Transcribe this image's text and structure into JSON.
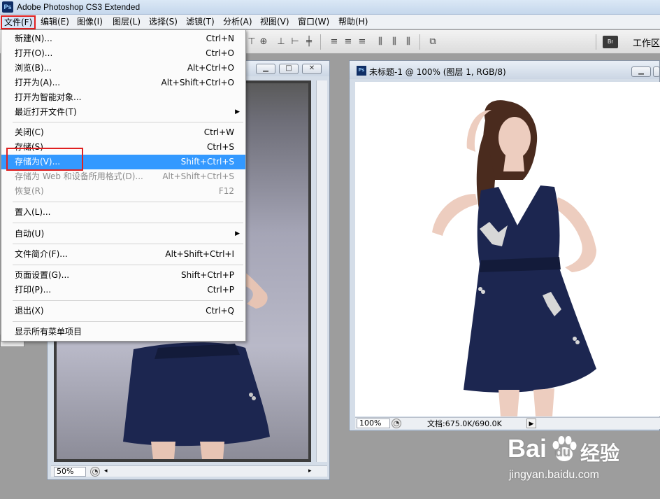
{
  "app": {
    "logo": "Ps",
    "title": "Adobe Photoshop CS3 Extended"
  },
  "menubar": {
    "items": [
      "文件(F)",
      "编辑(E)",
      "图像(I)",
      "图层(L)",
      "选择(S)",
      "滤镜(T)",
      "分析(A)",
      "视图(V)",
      "窗口(W)",
      "帮助(H)"
    ],
    "active_index": 0
  },
  "options_bar": {
    "bridge_label": "Br",
    "workspace_label": "工作区",
    "icons": [
      "align-top-icon",
      "align-vcenter-icon",
      "align-bottom-icon",
      "align-left-icon",
      "align-hcenter-icon",
      "align-right-icon",
      "distribute-top-icon",
      "distribute-vcenter-icon",
      "distribute-bottom-icon",
      "distribute-left-icon",
      "distribute-hcenter-icon",
      "distribute-right-icon",
      "auto-align-icon"
    ]
  },
  "file_menu": {
    "items": [
      {
        "label": "新建(N)...",
        "shortcut": "Ctrl+N"
      },
      {
        "label": "打开(O)...",
        "shortcut": "Ctrl+O"
      },
      {
        "label": "浏览(B)...",
        "shortcut": "Alt+Ctrl+O"
      },
      {
        "label": "打开为(A)...",
        "shortcut": "Alt+Shift+Ctrl+O"
      },
      {
        "label": "打开为智能对象...",
        "shortcut": ""
      },
      {
        "label": "最近打开文件(T)",
        "shortcut": "",
        "submenu": true
      },
      {
        "label": "关闭(C)",
        "shortcut": "Ctrl+W"
      },
      {
        "label": "存储(S)",
        "shortcut": "Ctrl+S"
      },
      {
        "label": "存储为(V)...",
        "shortcut": "Shift+Ctrl+S",
        "highlighted": true
      },
      {
        "label": "存储为 Web 和设备所用格式(D)...",
        "shortcut": "Alt+Shift+Ctrl+S",
        "disabled": true
      },
      {
        "label": "恢复(R)",
        "shortcut": "F12",
        "disabled": true
      },
      {
        "label": "置入(L)...",
        "shortcut": ""
      },
      {
        "label": "自动(U)",
        "shortcut": "",
        "submenu": true
      },
      {
        "label": "文件简介(F)...",
        "shortcut": "Alt+Shift+Ctrl+I"
      },
      {
        "label": "页面设置(G)...",
        "shortcut": "Shift+Ctrl+P"
      },
      {
        "label": "打印(P)...",
        "shortcut": "Ctrl+P"
      },
      {
        "label": "退出(X)",
        "shortcut": "Ctrl+Q"
      },
      {
        "label": "显示所有菜单项目",
        "shortcut": ""
      }
    ]
  },
  "left_document": {
    "zoom": "50%"
  },
  "right_document": {
    "icon": "Ps",
    "title": "未标题-1 @ 100% (图层 1, RGB/8)",
    "zoom": "100%",
    "doc_size": "文档:675.0K/690.0K"
  },
  "watermark": {
    "brand": "Bai",
    "brand_tail": "du",
    "cn": "经验",
    "url": "jingyan.baidu.com"
  },
  "colors": {
    "highlight": "#3399ff",
    "annotation_red": "#e02020",
    "dress": "#1c2650"
  }
}
